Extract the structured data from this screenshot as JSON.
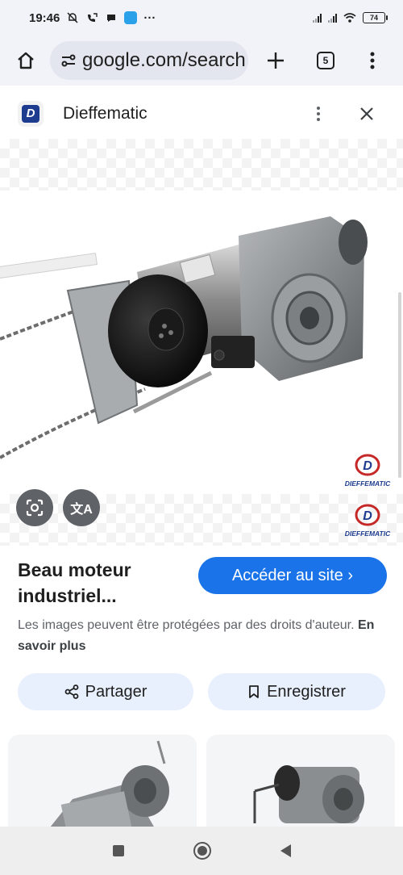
{
  "status_bar": {
    "time": "19:46",
    "icons": [
      "mute-icon",
      "call-forward-icon",
      "chat-icon",
      "app-badge-icon",
      "more-dots"
    ],
    "more": "···",
    "battery": "74"
  },
  "browser": {
    "url": "google.com/search",
    "tab_count": "5"
  },
  "source": {
    "site_name": "Dieffematic",
    "logo_letter": "D"
  },
  "image": {
    "watermark": "DIEFFEMATIC",
    "translate_glyph": "文A"
  },
  "result": {
    "title": "Beau moteur industriel...",
    "visit_label": "Accéder au site ›",
    "copyright_text": "Les images peuvent être protégées par des droits d'auteur.",
    "learn_more": "En savoir plus",
    "share_label": "Partager",
    "save_label": "Enregistrer"
  },
  "colors": {
    "accent": "#1a73e8",
    "pill_bg": "#e8f0fe",
    "chrome_bg": "#f1f3f8"
  }
}
